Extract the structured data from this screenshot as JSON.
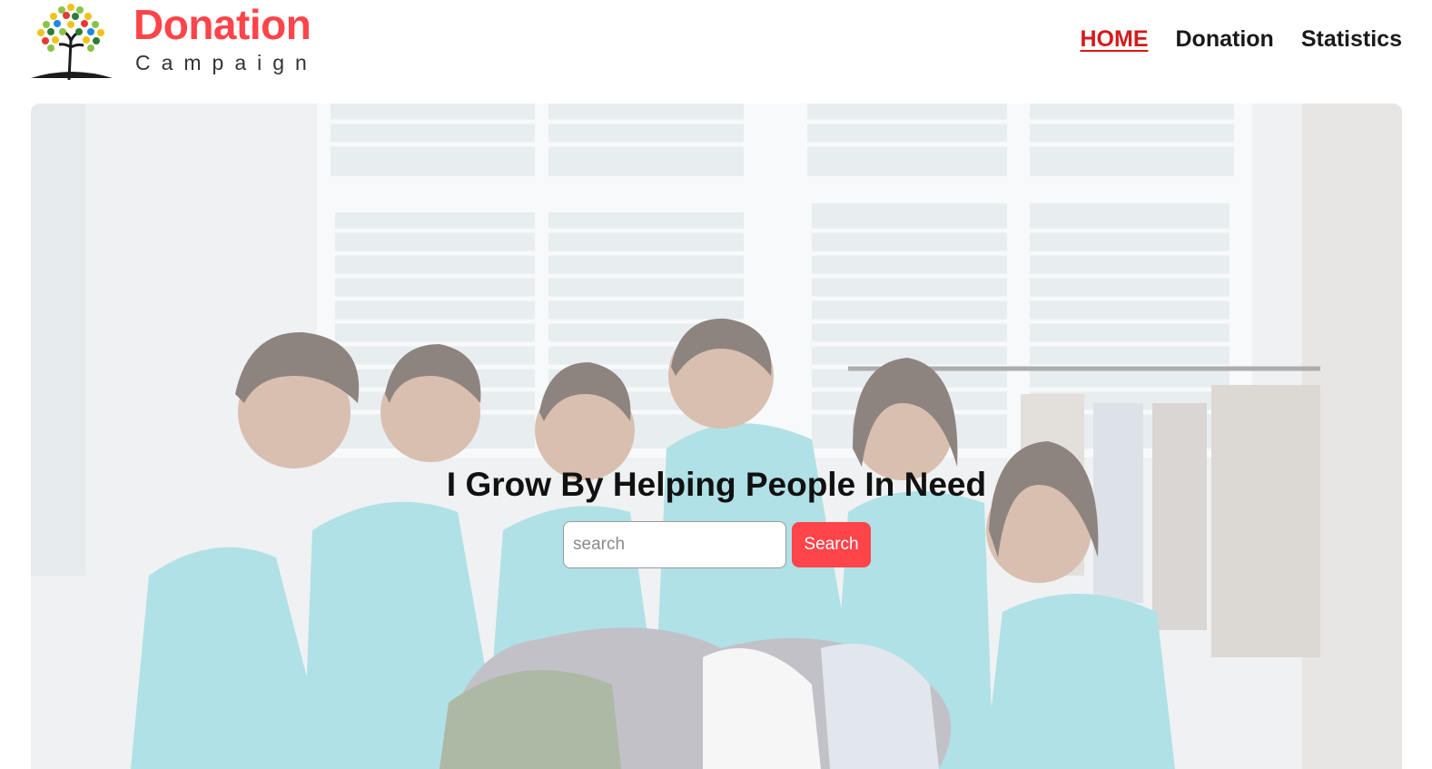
{
  "brand": {
    "title": "Donation",
    "subtitle": "Campaign",
    "accent_color": "#ff444a"
  },
  "nav": {
    "items": [
      {
        "label": "HOME",
        "active": true,
        "color": "#d51a1a"
      },
      {
        "label": "Donation",
        "active": false
      },
      {
        "label": "Statistics",
        "active": false
      }
    ]
  },
  "hero": {
    "heading": "I Grow By Helping People In Need",
    "search_placeholder": "search",
    "search_value": "",
    "search_button_label": "Search",
    "button_color": "#ff444a"
  }
}
